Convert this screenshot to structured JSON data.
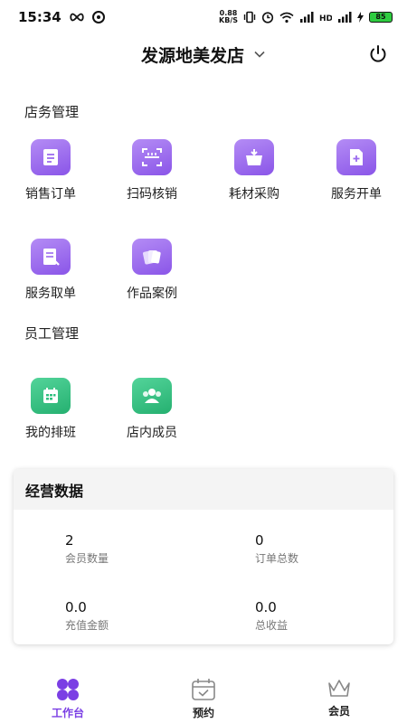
{
  "status_bar": {
    "time": "15:34",
    "net_speed_value": "0.88",
    "net_speed_unit": "KB/S",
    "battery": "85"
  },
  "header": {
    "store_name": "发源地美发店"
  },
  "store_section": {
    "title": "店务管理",
    "items": [
      {
        "label": "销售订单",
        "icon": "document-list-icon"
      },
      {
        "label": "扫码核销",
        "icon": "scan-icon"
      },
      {
        "label": "耗材采购",
        "icon": "basket-icon"
      },
      {
        "label": "服务开单",
        "icon": "add-document-icon"
      },
      {
        "label": "服务取单",
        "icon": "receipt-icon"
      },
      {
        "label": "作品案例",
        "icon": "photo-stack-icon"
      }
    ]
  },
  "staff_section": {
    "title": "员工管理",
    "items": [
      {
        "label": "我的排班",
        "icon": "calendar-icon"
      },
      {
        "label": "店内成员",
        "icon": "team-icon"
      }
    ]
  },
  "business_data": {
    "title": "经营数据",
    "stats": [
      {
        "value": "2",
        "label": "会员数量"
      },
      {
        "value": "0",
        "label": "订单总数"
      },
      {
        "value": "0.0",
        "label": "充值金额"
      },
      {
        "value": "0.0",
        "label": "总收益"
      }
    ]
  },
  "tabbar": {
    "tabs": [
      {
        "label": "工作台",
        "icon": "dashboard-icon",
        "active": true
      },
      {
        "label": "预约",
        "icon": "calendar-check-icon",
        "active": false
      },
      {
        "label": "会员",
        "icon": "crown-icon",
        "active": false
      }
    ]
  },
  "colors": {
    "accent": "#7b3fe4",
    "purple_icon": "#9b6bef",
    "green_icon": "#30c07f"
  }
}
